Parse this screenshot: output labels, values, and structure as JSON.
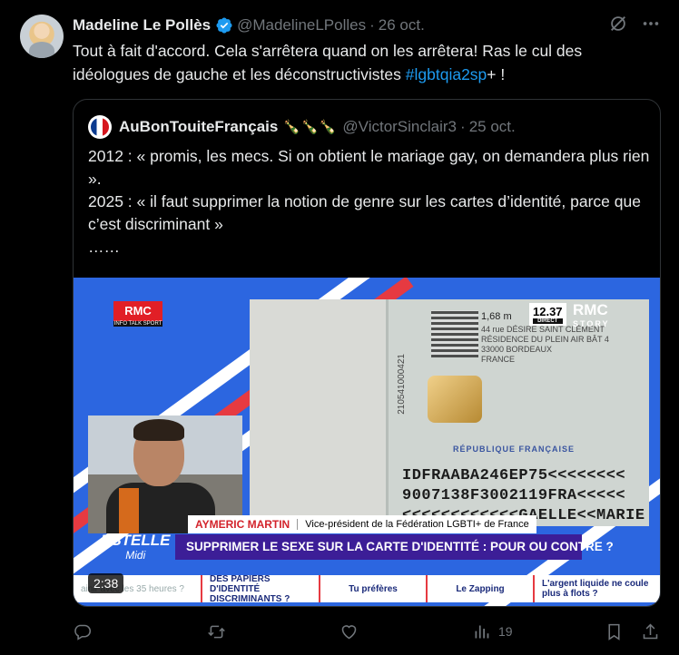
{
  "post": {
    "author_name": "Madeline Le Pollès",
    "handle": "@MadelineLPolles",
    "separator": "·",
    "date": "26 oct.",
    "text_main": "Tout à fait d'accord. Cela s'arrêtera quand on les arrêtera! Ras le cul des idéologues de gauche et les déconstructivistes ",
    "hashtag": "#lgbtqia2sp",
    "text_after": "+ !"
  },
  "quote": {
    "author_name": "AuBonTouiteFrançais",
    "emojis": "🍾🍾🍾",
    "handle": "@VictorSinclair3",
    "separator": "·",
    "date": "25 oct.",
    "line1": "2012 : « promis, les mecs. Si on obtient le mariage gay, on demandera plus rien ».",
    "line2": "2025 : « il faut supprimer la notion de genre sur les cartes d’identité, parce que c’est discriminant »",
    "line3": "……"
  },
  "video": {
    "duration": "2:38",
    "rmc_logo": "RMC",
    "rmc_sub": "INFO TALK SPORT",
    "clock": "12.37",
    "clock_sub": "DIRECT",
    "channel": "RMC",
    "channel_sub": "STORY",
    "guest_name": "AYMERIC MARTIN",
    "guest_role": "Vice-président de la Fédération LGBTI+ de France",
    "show_name": "ESTELLE",
    "show_sub": "Midi",
    "headline": "SUPPRIMER LE SEXE SUR LA CARTE D'IDENTITÉ : POUR OU CONTRE ?",
    "card_country": "RÉPUBLIQUE FRANÇAISE",
    "card_height": "1,68 m",
    "card_address": "44 rue DÉSIRÉ SAINT CLÉMENT\nRÉSIDENCE DU PLEIN AIR BÂT 4\n33000 BORDEAUX\nFRANCE",
    "card_number": "210541000421",
    "card_mrz": "IDFRAABA246EP75<<<<<<<<\n9007138F3002119FRA<<<<<\n<<<<<<<<<<<<GAELLE<<MARIE",
    "ticker": [
      "ainir avec les 35 heures ?",
      "DES PAPIERS D'IDENTITÉ DISCRIMINANTS ?",
      "Tu préfères",
      "Le Zapping",
      "L'argent liquide ne coule plus à flots ?"
    ]
  },
  "actions": {
    "views": "19"
  },
  "colors": {
    "background": "#000000",
    "text": "#e7e9ea",
    "muted": "#71767b",
    "link": "#1d9bf0",
    "verified": "#1d9bf0"
  },
  "icons": [
    "grok-icon",
    "more-icon",
    "reply-icon",
    "retweet-icon",
    "like-icon",
    "views-icon",
    "bookmark-icon",
    "share-icon",
    "verified-icon"
  ]
}
